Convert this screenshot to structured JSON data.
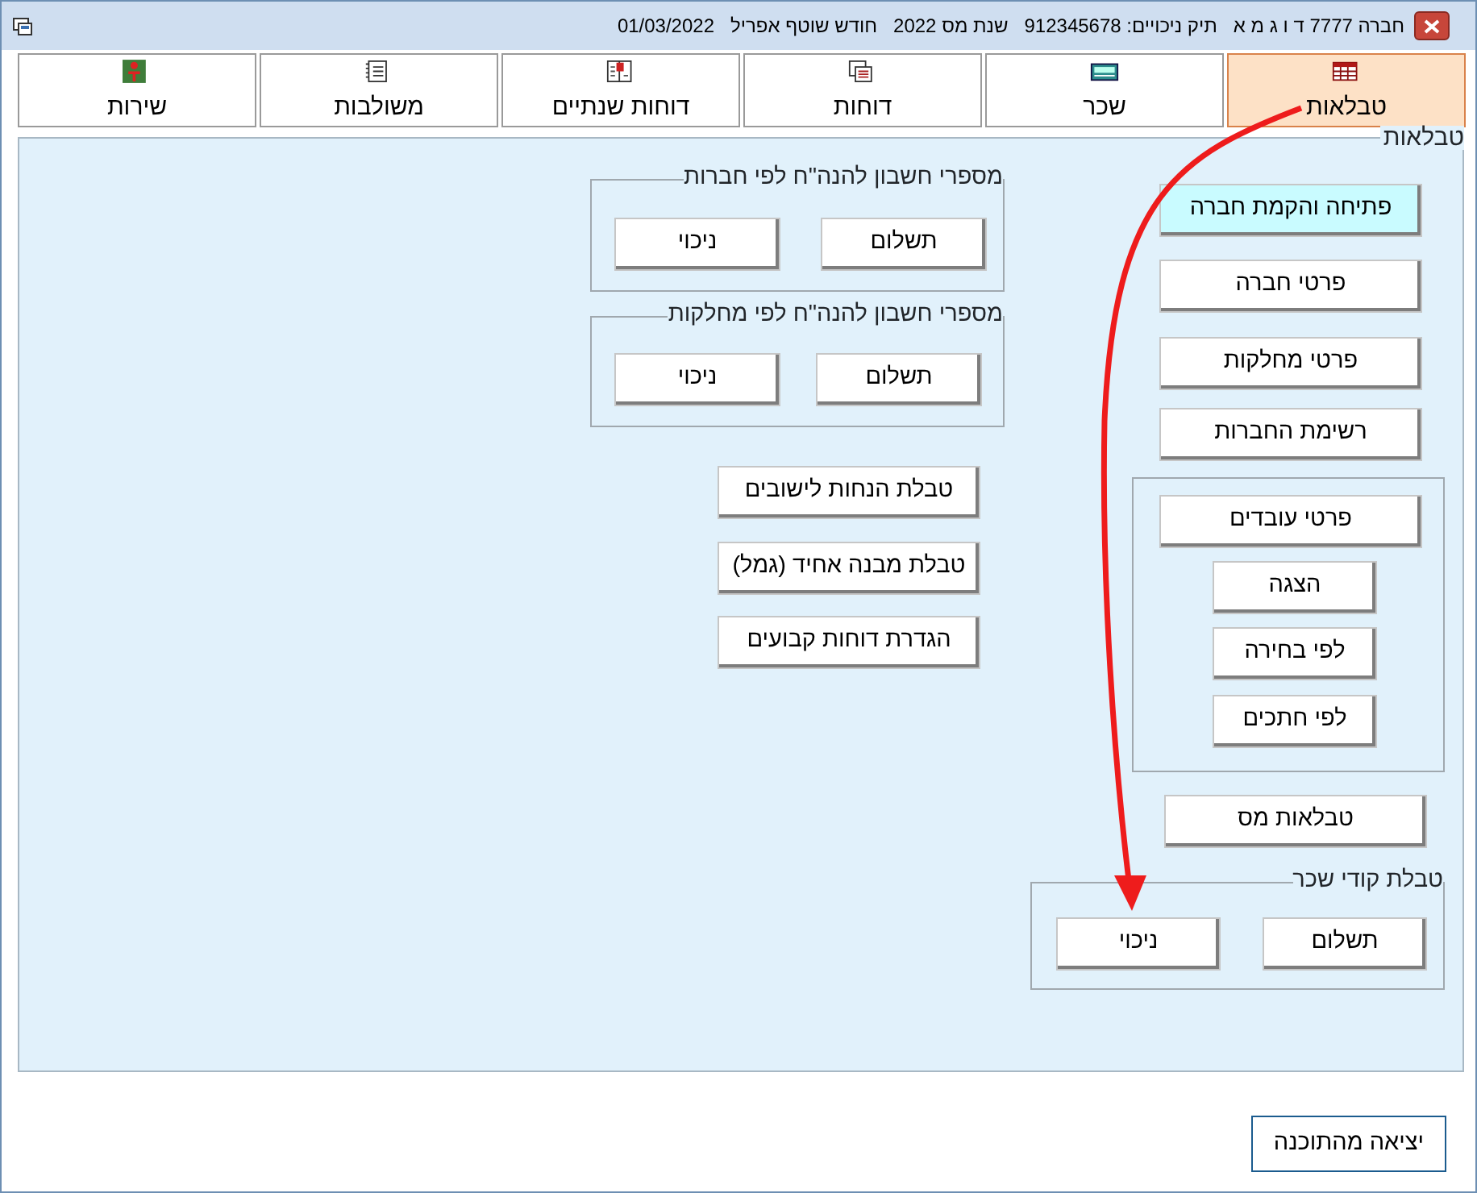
{
  "window": {
    "title_items": [
      "חברה 7777 ד ו ג מ א",
      "תיק ניכויים: 912345678",
      "שנת מס 2022",
      "חודש שוטף אפריל",
      "01/03/2022"
    ]
  },
  "tabs": [
    {
      "label": "טבלאות",
      "selected": true
    },
    {
      "label": "שכר",
      "selected": false
    },
    {
      "label": "דוחות",
      "selected": false
    },
    {
      "label": "דוחות שנתיים",
      "selected": false
    },
    {
      "label": "משולבות",
      "selected": false
    },
    {
      "label": "שירות",
      "selected": false
    }
  ],
  "panel": {
    "title": "טבלאות",
    "main_buttons": [
      {
        "label": "פתיחה והקמת חברה",
        "highlighted": true
      },
      {
        "label": "פרטי חברה",
        "highlighted": false
      },
      {
        "label": "פרטי מחלקות",
        "highlighted": false
      },
      {
        "label": "רשימת החברות",
        "highlighted": false
      }
    ],
    "employees_group": {
      "buttons": [
        "פרטי עובדים",
        "הצגה",
        "לפי בחירה",
        "לפי חתכים"
      ]
    },
    "tax_tables_button": "טבלאות מס",
    "wage_codes_group": {
      "title": "טבלת קודי שכר",
      "buttons": [
        "תשלום",
        "ניכוי"
      ]
    },
    "account_groups": [
      {
        "title": "מספרי חשבון להנה\"ח לפי חברות",
        "buttons": [
          "תשלום",
          "ניכוי"
        ]
      },
      {
        "title": "מספרי חשבון להנה\"ח לפי מחלקות",
        "buttons": [
          "תשלום",
          "ניכוי"
        ]
      }
    ],
    "table_buttons": [
      "טבלת הנחות לישובים",
      "טבלת מבנה אחיד (גמל)",
      "הגדרת דוחות קבועים"
    ]
  },
  "exit_button": "יציאה מהתוכנה"
}
